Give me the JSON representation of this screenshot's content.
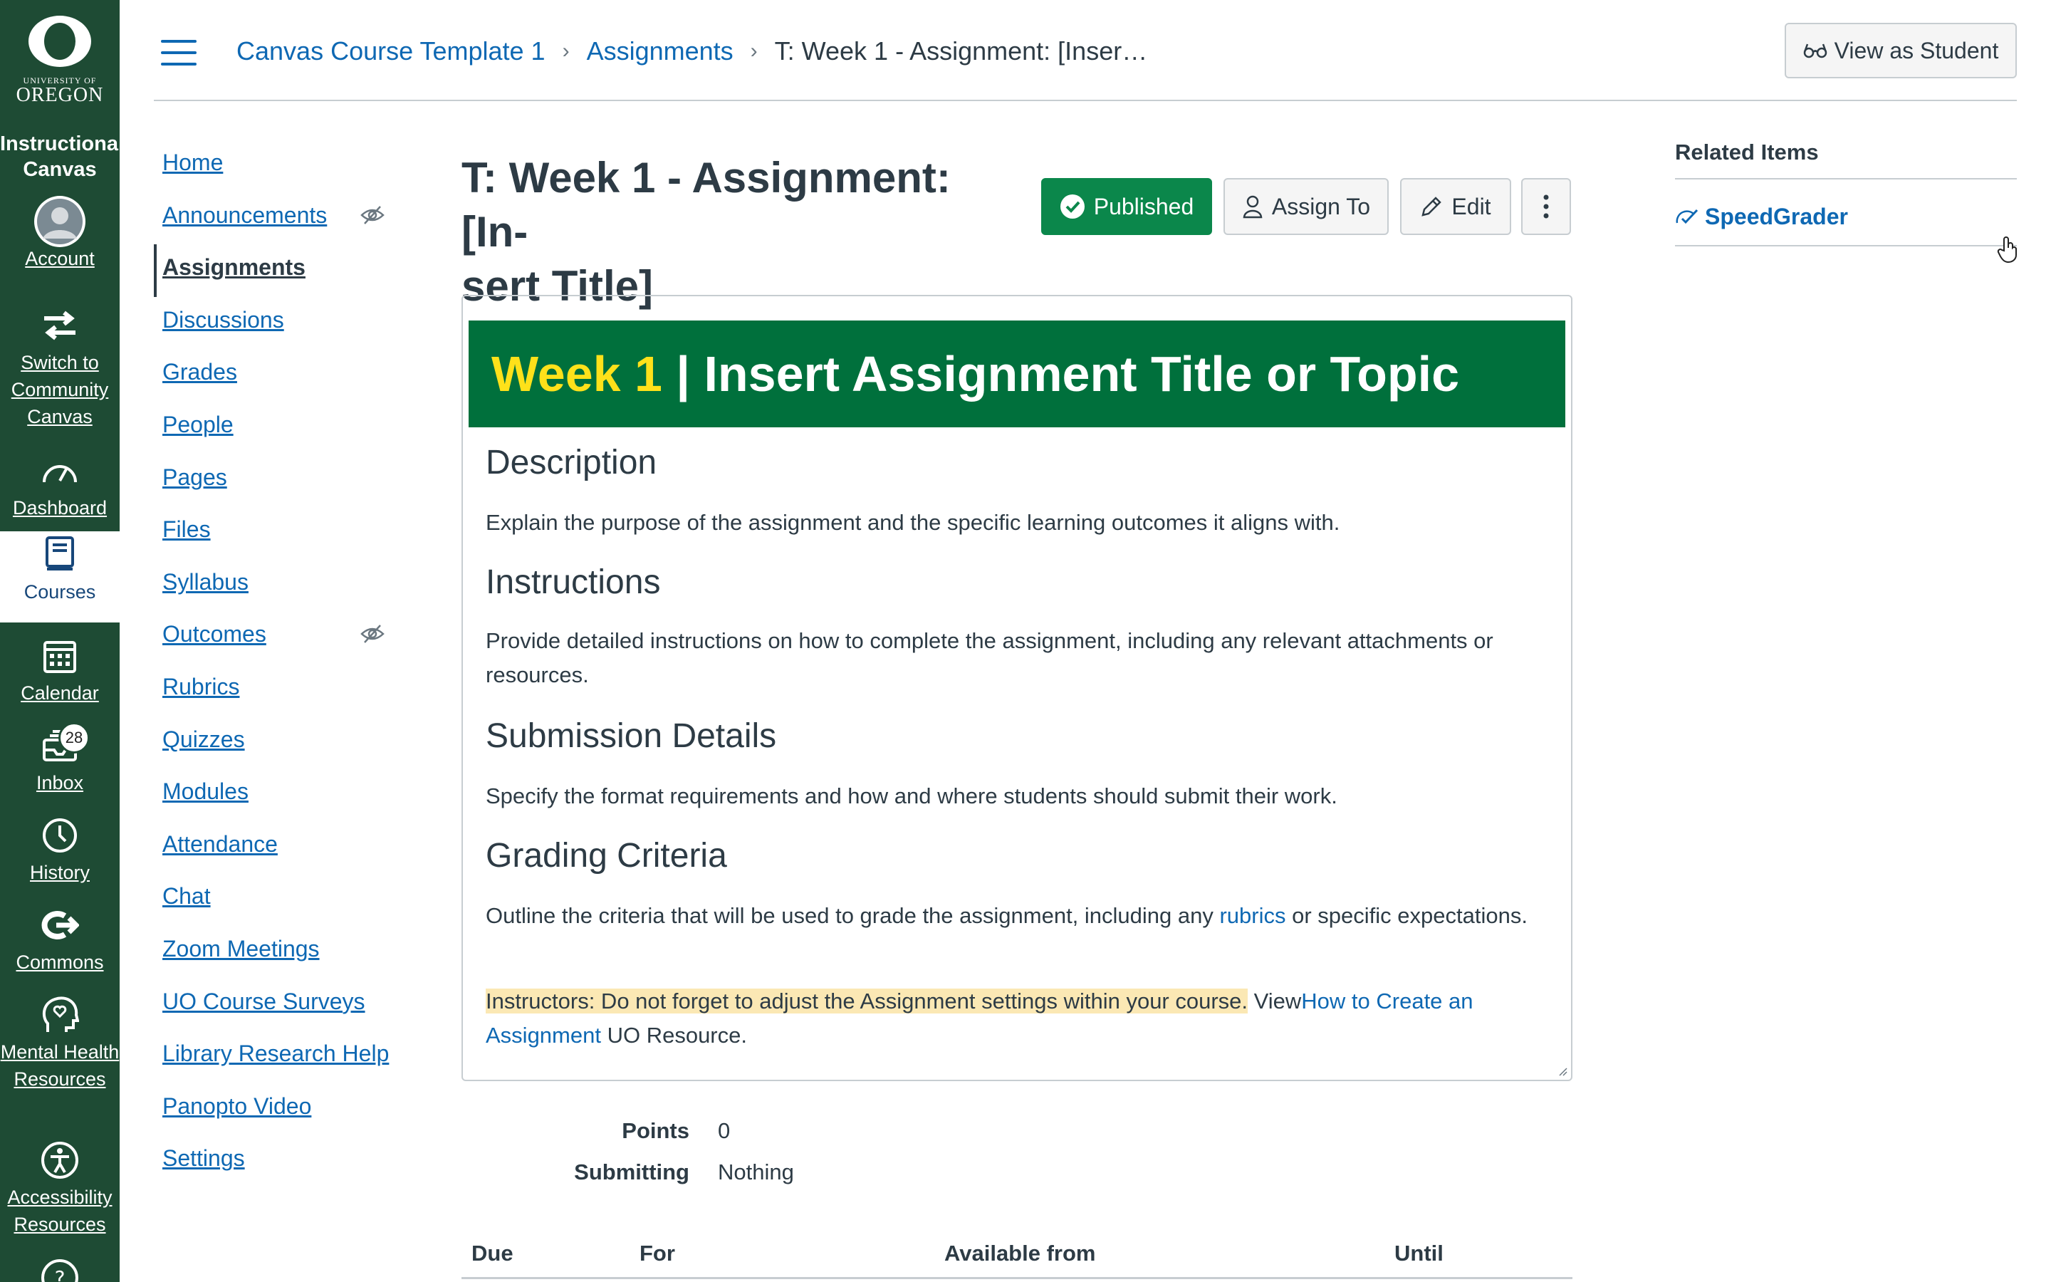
{
  "global_nav": {
    "logo_small": "UNIVERSITY OF",
    "logo_big": "OREGON",
    "instance": "Instructional Canvas",
    "items": [
      {
        "label": "Account",
        "icon": "avatar-icon"
      },
      {
        "label": "Switch to Community Canvas",
        "icon": "switch-arrows-icon"
      },
      {
        "label": "Dashboard",
        "icon": "dashboard-icon"
      },
      {
        "label": "Courses",
        "icon": "courses-icon",
        "active": true
      },
      {
        "label": "Calendar",
        "icon": "calendar-icon"
      },
      {
        "label": "Inbox",
        "icon": "inbox-icon",
        "badge": "28"
      },
      {
        "label": "History",
        "icon": "clock-icon"
      },
      {
        "label": "Commons",
        "icon": "commons-icon"
      },
      {
        "label": "Mental Health Resources",
        "icon": "heart-head-icon"
      },
      {
        "label": "Accessibility Resources",
        "icon": "accessibility-icon"
      }
    ]
  },
  "header": {
    "breadcrumbs": [
      "Canvas Course Template 1",
      "Assignments",
      "T: Week 1 - Assignment: [Inser…"
    ],
    "view_as_student": "View as Student"
  },
  "course_nav": [
    {
      "label": "Home"
    },
    {
      "label": "Announcements",
      "hidden": true
    },
    {
      "label": "Assignments",
      "active": true
    },
    {
      "label": "Discussions"
    },
    {
      "label": "Grades"
    },
    {
      "label": "People"
    },
    {
      "label": "Pages"
    },
    {
      "label": "Files"
    },
    {
      "label": "Syllabus"
    },
    {
      "label": "Outcomes",
      "hidden": true
    },
    {
      "label": "Rubrics"
    },
    {
      "label": "Quizzes"
    },
    {
      "label": "Modules"
    },
    {
      "label": "Attendance"
    },
    {
      "label": "Chat"
    },
    {
      "label": "Zoom Meetings"
    },
    {
      "label": "UO Course Surveys"
    },
    {
      "label": "Library Research Help"
    },
    {
      "label": "Panopto Video"
    },
    {
      "label": "Settings"
    }
  ],
  "assignment": {
    "title_line1": "T: Week 1 - Assignment: [In-",
    "title_line2": "sert Title]",
    "published_label": "Published",
    "assign_to_label": "Assign To",
    "edit_label": "Edit",
    "banner_week": "Week 1",
    "banner_rest": " | Insert Assignment Title or Topic",
    "sections": {
      "description_h": "Description",
      "description_p": "Explain the purpose of the assignment and the specific learning outcomes it aligns with.",
      "instructions_h": "Instructions",
      "instructions_p": "Provide detailed instructions on how to complete the assignment, including any relevant attachments or resources.",
      "submission_h": "Submission Details",
      "submission_p": "Specify the format requirements and how and where students should submit their work.",
      "grading_h": "Grading Criteria",
      "grading_p_before": "Outline the criteria that will be used to grade the assignment, including any ",
      "grading_link": "rubrics",
      "grading_p_after": " or specific expectations.",
      "note_highlight": "Instructors: Do not forget to adjust the Assignment settings within your course.",
      "note_view": " View",
      "note_link": "How to Create an Assignment",
      "note_after": " UO Resource."
    },
    "points_label": "Points",
    "points_value": "0",
    "submitting_label": "Submitting",
    "submitting_value": "Nothing",
    "table_headers": [
      "Due",
      "For",
      "Available from",
      "Until"
    ]
  },
  "related": {
    "title": "Related Items",
    "speedgrader": "SpeedGrader"
  },
  "colors": {
    "nav_green": "#1e4b34",
    "uo_green": "#00703c",
    "uo_yellow": "#fee11a",
    "link_blue": "#0e68b3",
    "published_green": "#0b874b"
  }
}
